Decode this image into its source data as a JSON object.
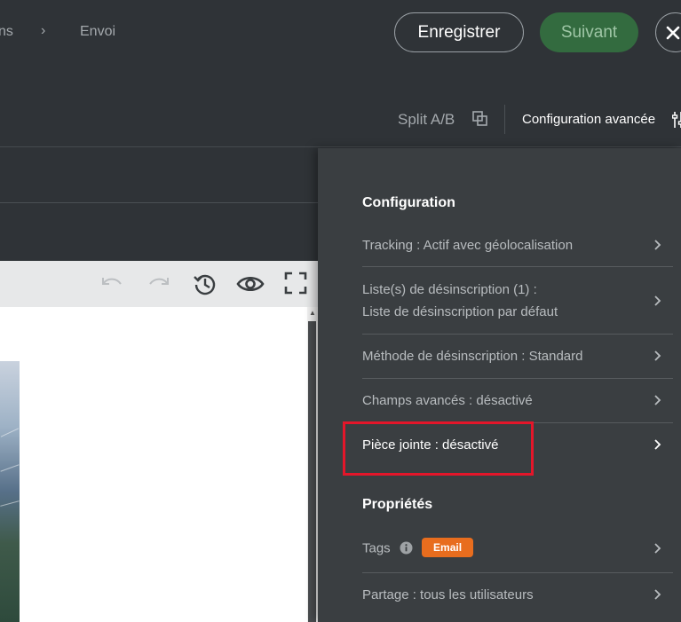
{
  "breadcrumb": {
    "prev_fragment": "ns",
    "separator": "›",
    "current": "Envoi"
  },
  "header": {
    "save_label": "Enregistrer",
    "next_label": "Suivant"
  },
  "subheader": {
    "split_label": "Split A/B",
    "advanced_label": "Configuration avancée"
  },
  "panel": {
    "configuration_title": "Configuration",
    "tracking": "Tracking :  Actif avec géolocalisation",
    "unsubscribe_lists_line1": "Liste(s) de désinscription (1) :",
    "unsubscribe_lists_line2": "Liste de désinscription par défaut",
    "unsubscribe_method": "Méthode de désinscription :  Standard",
    "advanced_fields": "Champs avancés :  désactivé",
    "attachment": "Pièce jointe :  désactivé",
    "properties_title": "Propriétés",
    "tags_label": "Tags",
    "tags_badge": "Email",
    "sharing": "Partage :  tous les utilisateurs"
  },
  "colors": {
    "background": "#2f3337",
    "panel": "#3a3e41",
    "next_button": "#336b3f",
    "badge": "#e86d1e",
    "highlight": "#e4162a"
  },
  "icons": [
    "chevron-right-icon",
    "close-icon",
    "split-icon",
    "advanced-settings-icon",
    "undo-icon",
    "redo-icon",
    "history-icon",
    "preview-eye-icon",
    "fullscreen-icon",
    "info-icon"
  ]
}
